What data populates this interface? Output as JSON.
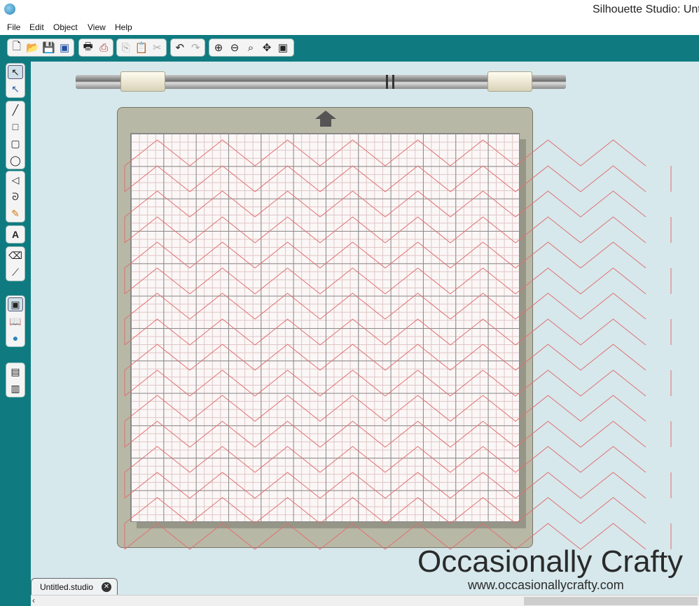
{
  "window": {
    "title": "Silhouette Studio: Untit"
  },
  "menu": {
    "items": [
      "File",
      "Edit",
      "Object",
      "View",
      "Help"
    ]
  },
  "toolbar": {
    "file_icons": [
      "new-file-icon",
      "open-folder-icon",
      "save-icon",
      "library-save-icon"
    ],
    "print_icons": [
      "print-icon",
      "print-cut-icon"
    ],
    "edit_icons": [
      "copy-icon",
      "paste-icon",
      "cut-icon"
    ],
    "history_icons": [
      "undo-icon",
      "redo-icon"
    ],
    "zoom_icons": [
      "zoom-in-icon",
      "zoom-out-icon",
      "zoom-select-icon",
      "pan-icon",
      "fit-page-icon"
    ]
  },
  "tools": {
    "select": [
      "select-icon",
      "point-edit-icon"
    ],
    "shapes": [
      "line-icon",
      "rectangle-icon",
      "rounded-rectangle-icon",
      "ellipse-icon"
    ],
    "draw": [
      "polygon-icon",
      "curve-icon",
      "freehand-icon"
    ],
    "text": [
      "text-icon"
    ],
    "erase": [
      "eraser-icon",
      "knife-icon"
    ],
    "panels": [
      "page-setup-icon",
      "library-icon",
      "store-icon"
    ],
    "windows": [
      "window-split-icon",
      "window-tile-icon"
    ],
    "text_label": "A"
  },
  "document": {
    "tab_label": "Untitled.studio",
    "accent_color": "#0f7b80",
    "cut_line_color": "#e07070"
  },
  "watermark": {
    "title": "Occasionally Crafty",
    "url": "www.occasionallycrafty.com"
  }
}
